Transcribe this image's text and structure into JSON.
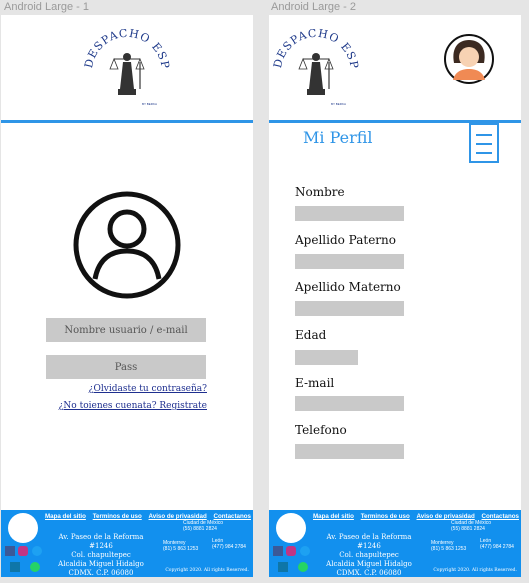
{
  "frame1": {
    "title": "Android Large - 1",
    "username_placeholder": "Nombre usuario / e-mail",
    "password_placeholder": "Pass",
    "forgot_link": "¿Olvidaste tu contraseña?",
    "register_link": "¿No toienes cuenata? Registrate"
  },
  "frame2": {
    "title": "Android Large - 2",
    "profile_title": "Mi Perfil",
    "fields": [
      "Nombre",
      "Apellido Paterno",
      "Apellido Materno",
      "Edad",
      "E-mail",
      "Telefono"
    ]
  },
  "logo": {
    "text": "DESPACHO ESPINOZA",
    "small": "BY BERKA"
  },
  "footer": {
    "links": [
      "Mapa del sitio",
      "Terminos de uso",
      "Aviso de privasidad",
      "Contactanos"
    ],
    "address": [
      "Av. Paseo de la Reforma #1246",
      "Col. chapultepec",
      "Alcaldia Miguel Hidalgo",
      "CDMX. C.P. 06080"
    ],
    "cities": [
      {
        "name": "Ciudad de México",
        "phone": "(55) 8881 2824"
      },
      {
        "name": "Monterrey",
        "phone": "(81) 5 863 1253"
      },
      {
        "name": "León",
        "phone": "(477) 984 2784"
      }
    ],
    "copyright": "Copyright 2020. All rights Reserved.",
    "social_colors": {
      "facebook": "#3b5998",
      "instagram": "#c13584",
      "twitter": "#1da1f2",
      "linkedin": "#0e76a8",
      "whatsapp": "#25d366"
    }
  }
}
